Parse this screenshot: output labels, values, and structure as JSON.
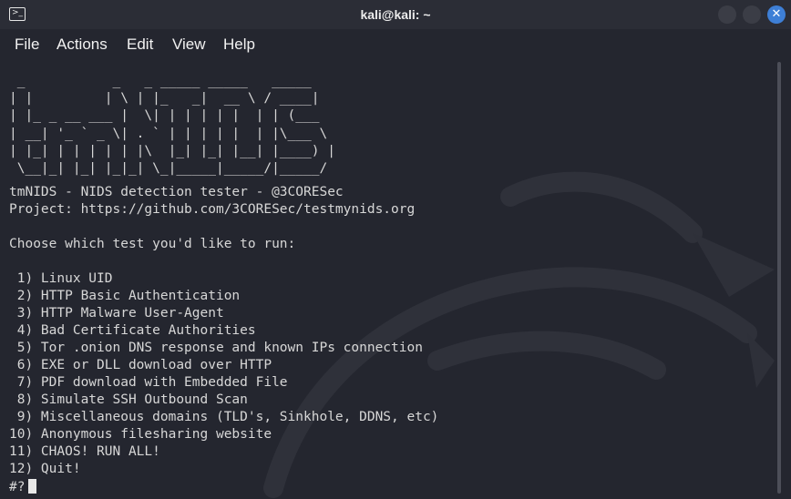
{
  "window": {
    "title": "kali@kali: ~"
  },
  "menu": {
    "file": "File",
    "actions": "Actions",
    "edit": "Edit",
    "view": "View",
    "help": "Help"
  },
  "terminal": {
    "ascii_logo": " _           _   _ _____ _____   _____ \n| |         | \\ | |_   _|  __ \\ / ____|\n| |_ _ __ ___ |  \\| | | | | |  | | (___  \n| __| '_ ` _ \\| . ` | | | | |  | |\\___ \\ \n| |_| | | | | | |\\  |_| |_| |__| |____) |\n \\__|_| |_| |_|_| \\_|_____|_____/|_____/ ",
    "header": "tmNIDS - NIDS detection tester - @3CORESec",
    "project": "Project: https://github.com/3CORESec/testmynids.org",
    "prompt_question": "Choose which test you'd like to run:",
    "options": [
      " 1) Linux UID",
      " 2) HTTP Basic Authentication",
      " 3) HTTP Malware User-Agent",
      " 4) Bad Certificate Authorities",
      " 5) Tor .onion DNS response and known IPs connection",
      " 6) EXE or DLL download over HTTP",
      " 7) PDF download with Embedded File",
      " 8) Simulate SSH Outbound Scan",
      " 9) Miscellaneous domains (TLD's, Sinkhole, DDNS, etc)",
      "10) Anonymous filesharing website",
      "11) CHAOS! RUN ALL!",
      "12) Quit!"
    ],
    "input_prompt": "#?"
  },
  "colors": {
    "background": "#24262f",
    "text": "#d7d7d7",
    "titlebar": "#2b2d36",
    "close_button": "#3e7fd6"
  },
  "icons": {
    "app": "terminal-icon",
    "minimize": "minimize-icon",
    "maximize": "maximize-icon",
    "close": "close-icon",
    "background": "kali-dragon-icon"
  }
}
